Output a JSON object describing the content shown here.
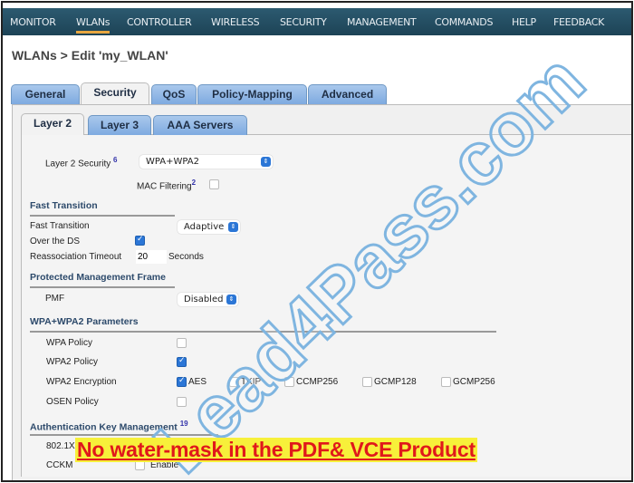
{
  "nav": [
    "MONITOR",
    "WLANs",
    "CONTROLLER",
    "WIRELESS",
    "SECURITY",
    "MANAGEMENT",
    "COMMANDS",
    "HELP",
    "FEEDBACK"
  ],
  "nav_active": "WLANs",
  "title": "WLANs > Edit  'my_WLAN'",
  "tabs": [
    "General",
    "Security",
    "QoS",
    "Policy-Mapping",
    "Advanced"
  ],
  "active_tab": "Security",
  "subtabs": [
    "Layer 2",
    "Layer 3",
    "AAA Servers"
  ],
  "active_subtab": "Layer 2",
  "layer2": {
    "security_label": "Layer 2 Security",
    "security_help": "6",
    "security_value": "WPA+WPA2",
    "mac_label": "MAC Filtering",
    "mac_help": "2",
    "mac_checked": false
  },
  "fast_transition": {
    "header": "Fast Transition",
    "ft_label": "Fast Transition",
    "ft_value": "Adaptive",
    "ds_label": "Over the DS",
    "ds_checked": true,
    "timeout_label": "Reassociation Timeout",
    "timeout_value": "20",
    "timeout_unit": "Seconds"
  },
  "pmf": {
    "header": "Protected Management Frame",
    "label": "PMF",
    "value": "Disabled"
  },
  "wpa": {
    "header": "WPA+WPA2 Parameters",
    "wpa_policy": "WPA Policy",
    "wpa2_policy": "WPA2 Policy",
    "wpa2_encryption": "WPA2 Encryption",
    "osen_policy": "OSEN Policy",
    "encryption_options": [
      {
        "label": "AES",
        "checked": true
      },
      {
        "label": "TKIP",
        "checked": false
      },
      {
        "label": "CCMP256",
        "checked": false
      },
      {
        "label": "GCMP128",
        "checked": false
      },
      {
        "label": "GCMP256",
        "checked": false
      }
    ]
  },
  "akm": {
    "header": "Authentication Key Management",
    "help": "19",
    "rows": [
      "802.1X",
      "CCKM"
    ],
    "enable": "Enable"
  },
  "watermark": "Lead4Pass.com",
  "banner": "No water-mask in the PDF& VCE Product",
  "colors": {
    "nav_bg": "#1d4356",
    "accent": "#e8a640",
    "tab": "#7eaae0",
    "checkbox": "#2b76d6",
    "banner_text": "#e0181b",
    "banner_bg": "#f7f03a"
  }
}
